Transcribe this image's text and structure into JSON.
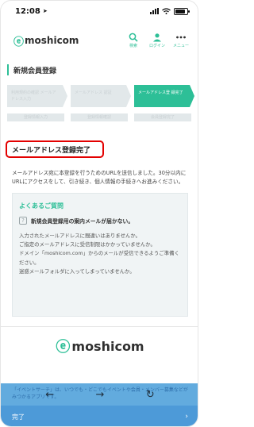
{
  "status_bar": {
    "time": "12:08"
  },
  "header": {
    "logo_text": "moshicom",
    "search_label": "検索",
    "login_label": "ログイン",
    "menu_label": "メニュー"
  },
  "page_title": "新規会員登録",
  "steps": {
    "row1": [
      {
        "label": "利用規約の確認 メールアドレス入力",
        "state": "done"
      },
      {
        "label": "メールアドレス 認証",
        "state": "done"
      },
      {
        "label": "メールアドレス登 録完了",
        "state": "active"
      }
    ],
    "row2": [
      {
        "label": "登録情報入力"
      },
      {
        "label": "登録情報確認"
      },
      {
        "label": "会員登録完了"
      }
    ]
  },
  "complete": {
    "heading": "メールアドレス登録完了",
    "description": "メールアドレス宛に本登録を行うためのURLを送信しました。30分以内にURLにアクセスをして、引き続き、個人情報の手続きへお進みください。"
  },
  "faq": {
    "title": "よくあるご質問",
    "question": "新規会員登録用の案内メールが届かない。",
    "answers": [
      "入力されたメールアドレスに間違いはありませんか。",
      "ご指定のメールアドレスに受信制限はかかっていませんか。",
      "ドメイン「moshicom.com」からのメールが受信できるようご準備ください。",
      "迷惑メールフォルダに入ってしまっていませんか。"
    ]
  },
  "footer": {
    "logo_text": "moshicom"
  },
  "banner_text": "「イベントサーチ」は、いつでも・どこでもイベントや会員・メンバー募集などがみつかるアプリです。",
  "keyboard_bar": {
    "done_label": "完了",
    "next_label": "›"
  },
  "colors": {
    "accent": "#2dbf97",
    "highlight_border": "#e30000",
    "keybar": "#4d9ad8"
  }
}
